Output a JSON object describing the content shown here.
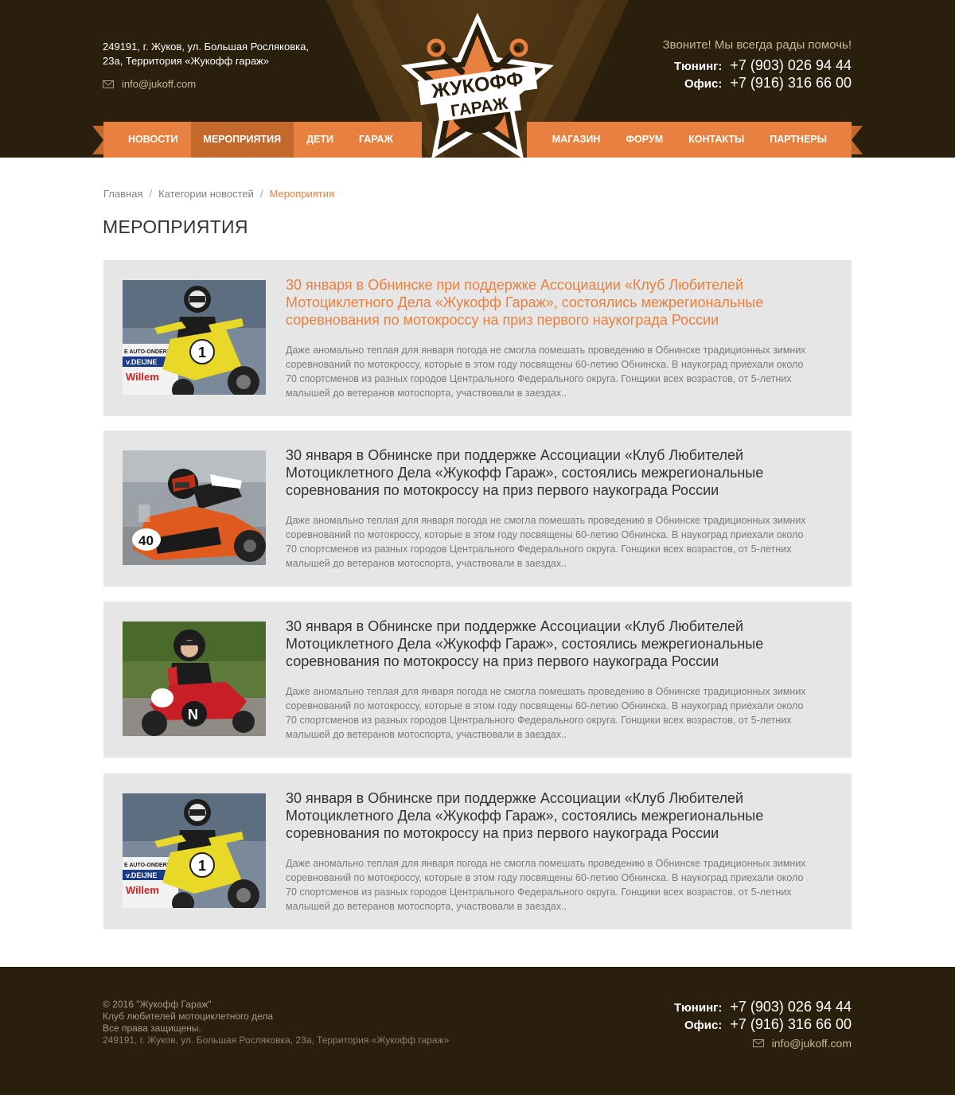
{
  "header": {
    "address_line1": "249191, г. Жуков, ул. Большая Росляковка,",
    "address_line2": "23а, Территория «Жукофф гараж»",
    "email": "info@jukoff.com",
    "call_text": "Звоните! Мы всегда рады помочь!",
    "phones": [
      {
        "label": "Тюнинг:",
        "number": "+7 (903) 026 94 44"
      },
      {
        "label": "Офис:",
        "number": "+7 (916) 316 66 00"
      }
    ],
    "logo_line1": "ЖУКОФФ",
    "logo_line2": "ГАРАЖ"
  },
  "nav": {
    "left": [
      "НОВОСТИ",
      "МЕРОПРИЯТИЯ",
      "ДЕТИ",
      "ГАРАЖ"
    ],
    "right": [
      "МАГАЗИН",
      "ФОРУМ",
      "КОНТАКТЫ",
      "ПАРТНЕРЫ"
    ],
    "active": "МЕРОПРИЯТИЯ"
  },
  "breadcrumb": {
    "home": "Главная",
    "category": "Категории новостей",
    "current": "Мероприятия",
    "separator": "/"
  },
  "page_title": "МЕРОПРИЯТИЯ",
  "articles": [
    {
      "title": "30 января в Обнинске при поддержке Ассоциации «Клуб Любителей Мотоциклетного Дела «Жукофф Гараж», состоялись межрегиональные соревнования по мотокроссу на приз первого наукограда России",
      "excerpt": "Даже аномально теплая для января погода не смогла помешать проведению в Обнинске традиционных зимних соревнований по мотокроссу, которые в этом году посвящены 60-летию Обнинска. В наукоград приехали около 70 спортсменов из разных городов Центрального Федерального округа. Гонщики всех возрастов, от 5-летних малышей до ветеранов мотоспорта, участвовали в заездах..",
      "image": "yellow-motocross-1",
      "image_text": [
        "E AUTO-ONDERDELEN",
        "v.DEIJNE",
        "Willem",
        "1"
      ]
    },
    {
      "title": "30 января в Обнинске при поддержке Ассоциации «Клуб Любителей Мотоциклетного Дела «Жукофф Гараж», состоялись межрегиональные соревнования по мотокроссу на приз первого наукограда России",
      "excerpt": "Даже аномально теплая для января погода не смогла помешать проведению в Обнинске традиционных зимних соревнований по мотокроссу, которые в этом году посвящены 60-летию Обнинска. В наукоград приехали около 70 спортсменов из разных городов Центрального Федерального округа. Гонщики всех возрастов, от 5-летних малышей до ветеранов мотоспорта, участвовали в заездах..",
      "image": "red-minibike-40",
      "image_text": [
        "40"
      ]
    },
    {
      "title": "30 января в Обнинске при поддержке Ассоциации «Клуб Любителей Мотоциклетного Дела «Жукофф Гараж», состоялись межрегиональные соревнования по мотокроссу на приз первого наукограда России",
      "excerpt": "Даже аномально теплая для января погода не смогла помешать проведению в Обнинске традиционных зимних соревнований по мотокроссу, которые в этом году посвящены 60-летию Обнинска. В наукоград приехали около 70 спортсменов из разных городов Центрального Федерального округа. Гонщики всех возрастов, от 5-летних малышей до ветеранов мотоспорта, участвовали в заездах..",
      "image": "child-on-minibike",
      "image_text": [
        "N"
      ]
    },
    {
      "title": "30 января в Обнинске при поддержке Ассоциации «Клуб Любителей Мотоциклетного Дела «Жукофф Гараж», состоялись межрегиональные соревнования по мотокроссу на приз первого наукограда России",
      "excerpt": "Даже аномально теплая для января погода не смогла помешать проведению в Обнинске традиционных зимних соревнований по мотокроссу, которые в этом году посвящены 60-летию Обнинска. В наукоград приехали около 70 спортсменов из разных городов Центрального Федерального округа. Гонщики всех возрастов, от 5-летних малышей до ветеранов мотоспорта, участвовали в заездах..",
      "image": "yellow-motocross-1",
      "image_text": [
        "E AUTO-ONDERDELEN",
        "v.DEIJNE",
        "Willem",
        "1"
      ]
    }
  ],
  "footer": {
    "copyright": "© 2016 \"Жукофф Гараж\"",
    "club": "Клуб любителей мотоциклетного дела",
    "rights": "Все права защищены.",
    "address": "249191, г. Жуков, ул. Большая Росляковка, 23а, Территория «Жукофф гараж»",
    "phones": [
      {
        "label": "Тюнинг:",
        "number": "+7 (903) 026 94 44"
      },
      {
        "label": "Офис:",
        "number": "+7 (916) 316 66 00"
      }
    ],
    "email": "info@jukoff.com"
  },
  "colors": {
    "accent": "#e8813f",
    "accent_dark": "#c4692c",
    "header_bg": "#2a1e0c",
    "card_bg": "#e6e6e6"
  }
}
